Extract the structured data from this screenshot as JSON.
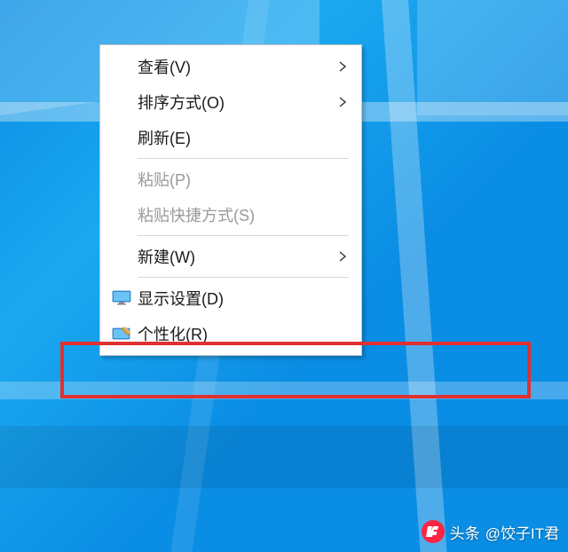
{
  "menu": {
    "items": [
      {
        "label": "查看(V)",
        "submenu": true,
        "disabled": false,
        "icon": null
      },
      {
        "label": "排序方式(O)",
        "submenu": true,
        "disabled": false,
        "icon": null
      },
      {
        "label": "刷新(E)",
        "submenu": false,
        "disabled": false,
        "icon": null
      },
      {
        "sep": true
      },
      {
        "label": "粘贴(P)",
        "submenu": false,
        "disabled": true,
        "icon": null
      },
      {
        "label": "粘贴快捷方式(S)",
        "submenu": false,
        "disabled": true,
        "icon": null
      },
      {
        "sep": true
      },
      {
        "label": "新建(W)",
        "submenu": true,
        "disabled": false,
        "icon": null
      },
      {
        "sep": true
      },
      {
        "label": "显示设置(D)",
        "submenu": false,
        "disabled": false,
        "icon": "monitor"
      },
      {
        "label": "个性化(R)",
        "submenu": false,
        "disabled": false,
        "icon": "personalize"
      }
    ]
  },
  "watermark": {
    "prefix": "头条",
    "handle": "@饺子IT君"
  }
}
